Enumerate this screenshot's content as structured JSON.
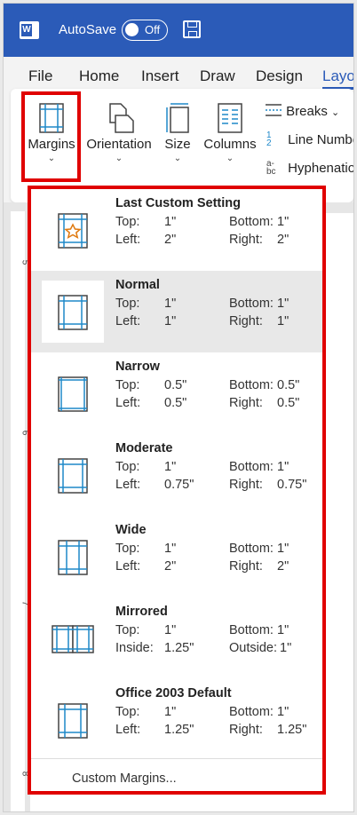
{
  "titlebar": {
    "app_letter": "W",
    "autosave_label": "AutoSave",
    "toggle_state": "Off"
  },
  "menu": [
    {
      "label": "File"
    },
    {
      "label": "Home"
    },
    {
      "label": "Insert"
    },
    {
      "label": "Draw"
    },
    {
      "label": "Design"
    },
    {
      "label": "Layo"
    }
  ],
  "ribbon": {
    "margins": "Margins",
    "orientation": "Orientation",
    "size": "Size",
    "columns": "Columns",
    "breaks": "Breaks",
    "line_numbers": "Line Numbe",
    "hyphenation": "Hyphenatio",
    "line_numbers_glyph": "1",
    "line_numbers_glyph2": "2",
    "hyphen_glyph": "a-",
    "hyphen_glyph2": "bc"
  },
  "ruler_numbers": [
    "5",
    "6",
    "7",
    "8"
  ],
  "margins_menu": {
    "options": [
      {
        "name": "Last Custom Setting",
        "l1": "Top:",
        "v1": "1\"",
        "l2": "Bottom:",
        "v2": "1\"",
        "l3": "Left:",
        "v3": "2\"",
        "l4": "Right:",
        "v4": "2\""
      },
      {
        "name": "Normal",
        "l1": "Top:",
        "v1": "1\"",
        "l2": "Bottom:",
        "v2": "1\"",
        "l3": "Left:",
        "v3": "1\"",
        "l4": "Right:",
        "v4": "1\""
      },
      {
        "name": "Narrow",
        "l1": "Top:",
        "v1": "0.5\"",
        "l2": "Bottom:",
        "v2": "0.5\"",
        "l3": "Left:",
        "v3": "0.5\"",
        "l4": "Right:",
        "v4": "0.5\""
      },
      {
        "name": "Moderate",
        "l1": "Top:",
        "v1": "1\"",
        "l2": "Bottom:",
        "v2": "1\"",
        "l3": "Left:",
        "v3": "0.75\"",
        "l4": "Right:",
        "v4": "0.75\""
      },
      {
        "name": "Wide",
        "l1": "Top:",
        "v1": "1\"",
        "l2": "Bottom:",
        "v2": "1\"",
        "l3": "Left:",
        "v3": "2\"",
        "l4": "Right:",
        "v4": "2\""
      },
      {
        "name": "Mirrored",
        "l1": "Top:",
        "v1": "1\"",
        "l2": "Bottom:",
        "v2": "1\"",
        "l3": "Inside:",
        "v3": "1.25\"",
        "l4": "Outside:",
        "v4": "1\""
      },
      {
        "name": "Office 2003 Default",
        "l1": "Top:",
        "v1": "1\"",
        "l2": "Bottom:",
        "v2": "1\"",
        "l3": "Left:",
        "v3": "1.25\"",
        "l4": "Right:",
        "v4": "1.25\""
      }
    ],
    "custom_margins": "Custom Margins...",
    "selected_option": "Normal"
  },
  "colors": {
    "title_bar": "#2b5bb8",
    "highlight": "#e00000",
    "icon_blue": "#1e88c9",
    "star": "#e07a10"
  }
}
